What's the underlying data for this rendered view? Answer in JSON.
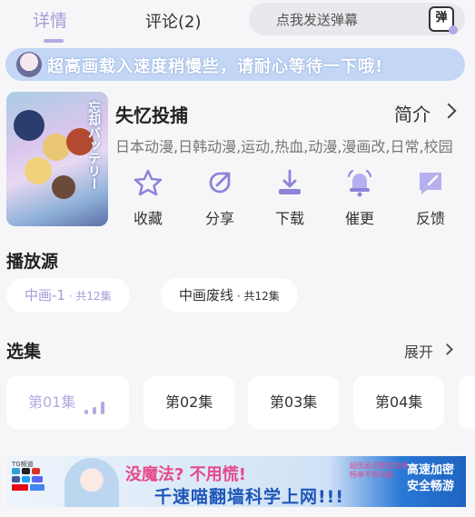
{
  "tabs": {
    "detail": "详情",
    "comments": "评论(2)"
  },
  "danmu": {
    "placeholder": "点我发送弹幕",
    "button": "弹"
  },
  "notice": "超高画载入速度稍慢些，请耐心等待一下哦!",
  "anime": {
    "title": "失忆投捕",
    "intro_label": "简介",
    "tags": "日本动漫,日韩动漫,运动,热血,动漫,漫画改,日常,校园",
    "cover_title": "忘却バッテリー"
  },
  "actions": [
    {
      "label": "收藏",
      "icon": "star-icon"
    },
    {
      "label": "分享",
      "icon": "share-icon"
    },
    {
      "label": "下载",
      "icon": "download-icon"
    },
    {
      "label": "催更",
      "icon": "bell-icon"
    },
    {
      "label": "反馈",
      "icon": "feedback-icon"
    }
  ],
  "sources": {
    "heading": "播放源",
    "items": [
      {
        "name": "中画-1",
        "count": " · 共12集"
      },
      {
        "name": "中画废线",
        "count": " · 共12集"
      }
    ]
  },
  "episodes": {
    "heading": "选集",
    "expand_label": "展开",
    "items": [
      "第01集",
      "第02集",
      "第03集",
      "第04集"
    ]
  },
  "ad": {
    "line1": "没魔法? 不用慌!",
    "line2": "千速喵翻墙科学上网!!!",
    "side_text_1": "超低延迟稳定加速",
    "side_text_2": "畅享不限流量",
    "badge": "高速加密 安全畅游",
    "brand": "TG频道"
  },
  "colors": {
    "accent": "#a99bd9",
    "notice_bg": "#c3d6f5"
  }
}
